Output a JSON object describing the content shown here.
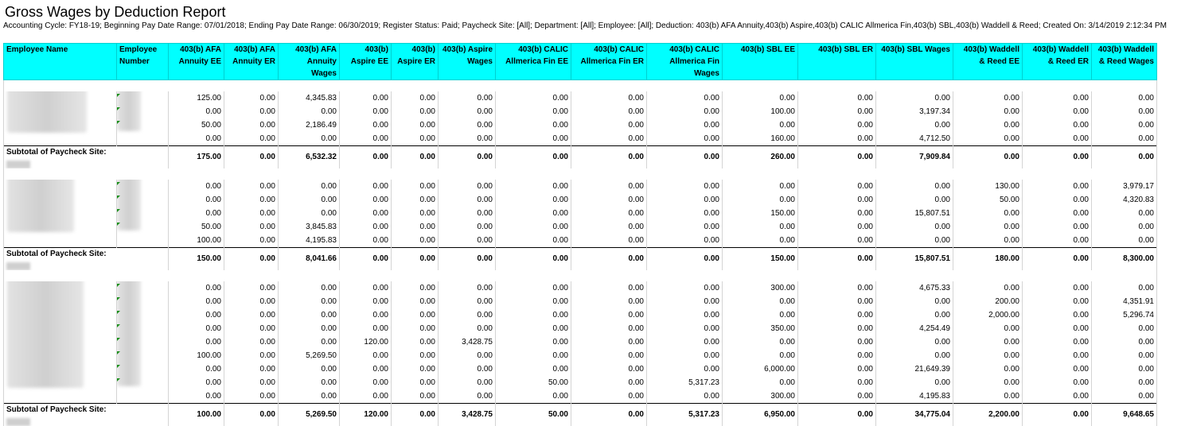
{
  "report": {
    "title": "Gross Wages by Deduction Report",
    "parameters": "Accounting Cycle: FY18-19; Beginning Pay Date Range: 07/01/2018; Ending Pay Date Range: 06/30/2019; Register Status: Paid; Paycheck Site: [All]; Department: [All]; Employee: [All]; Deduction: 403(b) AFA Annuity,403(b) Aspire,403(b) CALIC Allmerica Fin,403(b) SBL,403(b) Waddell & Reed; Created On: 3/14/2019 2:12:34 PM"
  },
  "columns": [
    "Employee Name",
    "Employee Number",
    "403(b) AFA Annuity EE",
    "403(b) AFA Annuity ER",
    "403(b) AFA Annuity Wages",
    "403(b) Aspire EE",
    "403(b) Aspire ER",
    "403(b) Aspire Wages",
    "403(b) CALIC Allmerica Fin EE",
    "403(b) CALIC Allmerica Fin ER",
    "403(b) CALIC Allmerica Fin Wages",
    "403(b) SBL EE",
    "403(b) SBL ER",
    "403(b) SBL Wages",
    "403(b) Waddell & Reed EE",
    "403(b) Waddell & Reed ER",
    "403(b) Waddell & Reed Wages"
  ],
  "subtotal_label": "Subtotal of Paycheck Site:",
  "groups": [
    {
      "rows": [
        [
          "125.00",
          "0.00",
          "4,345.83",
          "0.00",
          "0.00",
          "0.00",
          "0.00",
          "0.00",
          "0.00",
          "0.00",
          "0.00",
          "0.00",
          "0.00",
          "0.00",
          "0.00"
        ],
        [
          "0.00",
          "0.00",
          "0.00",
          "0.00",
          "0.00",
          "0.00",
          "0.00",
          "0.00",
          "0.00",
          "100.00",
          "0.00",
          "3,197.34",
          "0.00",
          "0.00",
          "0.00"
        ],
        [
          "50.00",
          "0.00",
          "2,186.49",
          "0.00",
          "0.00",
          "0.00",
          "0.00",
          "0.00",
          "0.00",
          "0.00",
          "0.00",
          "0.00",
          "0.00",
          "0.00",
          "0.00"
        ],
        [
          "0.00",
          "0.00",
          "0.00",
          "0.00",
          "0.00",
          "0.00",
          "0.00",
          "0.00",
          "0.00",
          "160.00",
          "0.00",
          "4,712.50",
          "0.00",
          "0.00",
          "0.00"
        ]
      ],
      "subtotal": [
        "175.00",
        "0.00",
        "6,532.32",
        "0.00",
        "0.00",
        "0.00",
        "0.00",
        "0.00",
        "0.00",
        "260.00",
        "0.00",
        "7,909.84",
        "0.00",
        "0.00",
        "0.00"
      ]
    },
    {
      "rows": [
        [
          "0.00",
          "0.00",
          "0.00",
          "0.00",
          "0.00",
          "0.00",
          "0.00",
          "0.00",
          "0.00",
          "0.00",
          "0.00",
          "0.00",
          "130.00",
          "0.00",
          "3,979.17"
        ],
        [
          "0.00",
          "0.00",
          "0.00",
          "0.00",
          "0.00",
          "0.00",
          "0.00",
          "0.00",
          "0.00",
          "0.00",
          "0.00",
          "0.00",
          "50.00",
          "0.00",
          "4,320.83"
        ],
        [
          "0.00",
          "0.00",
          "0.00",
          "0.00",
          "0.00",
          "0.00",
          "0.00",
          "0.00",
          "0.00",
          "150.00",
          "0.00",
          "15,807.51",
          "0.00",
          "0.00",
          "0.00"
        ],
        [
          "50.00",
          "0.00",
          "3,845.83",
          "0.00",
          "0.00",
          "0.00",
          "0.00",
          "0.00",
          "0.00",
          "0.00",
          "0.00",
          "0.00",
          "0.00",
          "0.00",
          "0.00"
        ],
        [
          "100.00",
          "0.00",
          "4,195.83",
          "0.00",
          "0.00",
          "0.00",
          "0.00",
          "0.00",
          "0.00",
          "0.00",
          "0.00",
          "0.00",
          "0.00",
          "0.00",
          "0.00"
        ]
      ],
      "subtotal": [
        "150.00",
        "0.00",
        "8,041.66",
        "0.00",
        "0.00",
        "0.00",
        "0.00",
        "0.00",
        "0.00",
        "150.00",
        "0.00",
        "15,807.51",
        "180.00",
        "0.00",
        "8,300.00"
      ]
    },
    {
      "rows": [
        [
          "0.00",
          "0.00",
          "0.00",
          "0.00",
          "0.00",
          "0.00",
          "0.00",
          "0.00",
          "0.00",
          "300.00",
          "0.00",
          "4,675.33",
          "0.00",
          "0.00",
          "0.00"
        ],
        [
          "0.00",
          "0.00",
          "0.00",
          "0.00",
          "0.00",
          "0.00",
          "0.00",
          "0.00",
          "0.00",
          "0.00",
          "0.00",
          "0.00",
          "200.00",
          "0.00",
          "4,351.91"
        ],
        [
          "0.00",
          "0.00",
          "0.00",
          "0.00",
          "0.00",
          "0.00",
          "0.00",
          "0.00",
          "0.00",
          "0.00",
          "0.00",
          "0.00",
          "2,000.00",
          "0.00",
          "5,296.74"
        ],
        [
          "0.00",
          "0.00",
          "0.00",
          "0.00",
          "0.00",
          "0.00",
          "0.00",
          "0.00",
          "0.00",
          "350.00",
          "0.00",
          "4,254.49",
          "0.00",
          "0.00",
          "0.00"
        ],
        [
          "0.00",
          "0.00",
          "0.00",
          "120.00",
          "0.00",
          "3,428.75",
          "0.00",
          "0.00",
          "0.00",
          "0.00",
          "0.00",
          "0.00",
          "0.00",
          "0.00",
          "0.00"
        ],
        [
          "100.00",
          "0.00",
          "5,269.50",
          "0.00",
          "0.00",
          "0.00",
          "0.00",
          "0.00",
          "0.00",
          "0.00",
          "0.00",
          "0.00",
          "0.00",
          "0.00",
          "0.00"
        ],
        [
          "0.00",
          "0.00",
          "0.00",
          "0.00",
          "0.00",
          "0.00",
          "0.00",
          "0.00",
          "0.00",
          "6,000.00",
          "0.00",
          "21,649.39",
          "0.00",
          "0.00",
          "0.00"
        ],
        [
          "0.00",
          "0.00",
          "0.00",
          "0.00",
          "0.00",
          "0.00",
          "50.00",
          "0.00",
          "5,317.23",
          "0.00",
          "0.00",
          "0.00",
          "0.00",
          "0.00",
          "0.00"
        ],
        [
          "0.00",
          "0.00",
          "0.00",
          "0.00",
          "0.00",
          "0.00",
          "0.00",
          "0.00",
          "0.00",
          "300.00",
          "0.00",
          "4,195.83",
          "0.00",
          "0.00",
          "0.00"
        ]
      ],
      "subtotal": [
        "100.00",
        "0.00",
        "5,269.50",
        "120.00",
        "0.00",
        "3,428.75",
        "50.00",
        "0.00",
        "5,317.23",
        "6,950.00",
        "0.00",
        "34,775.04",
        "2,200.00",
        "0.00",
        "9,648.65"
      ]
    }
  ]
}
